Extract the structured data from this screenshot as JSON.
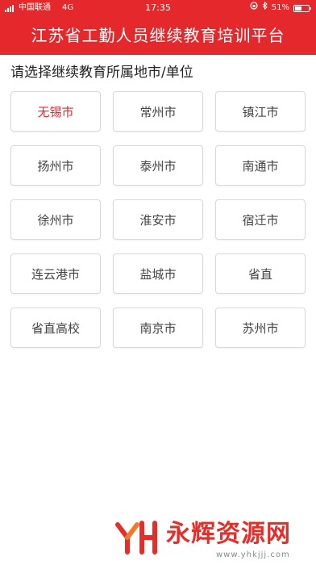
{
  "status_bar": {
    "carrier": "中国联通",
    "network": "4G",
    "time": "17:35",
    "battery": "51%",
    "battery_level": 0.51
  },
  "header": {
    "title": "江苏省工勤人员继续教育培训平台",
    "background": "#e4282c"
  },
  "prompt": "请选择继续教育所属地市/单位",
  "cities": [
    {
      "label": "无锡市",
      "selected": true
    },
    {
      "label": "常州市",
      "selected": false
    },
    {
      "label": "镇江市",
      "selected": false
    },
    {
      "label": "扬州市",
      "selected": false
    },
    {
      "label": "泰州市",
      "selected": false
    },
    {
      "label": "南通市",
      "selected": false
    },
    {
      "label": "徐州市",
      "selected": false
    },
    {
      "label": "淮安市",
      "selected": false
    },
    {
      "label": "宿迁市",
      "selected": false
    },
    {
      "label": "连云港市",
      "selected": false
    },
    {
      "label": "盐城市",
      "selected": false
    },
    {
      "label": "省直",
      "selected": false
    },
    {
      "label": "省直高校",
      "selected": false
    },
    {
      "label": "南京市",
      "selected": false
    },
    {
      "label": "苏州市",
      "selected": false
    }
  ],
  "selected_color": "#e4282c",
  "watermark": {
    "text": "永辉资源网",
    "url": "www.yhkjjj.com"
  }
}
